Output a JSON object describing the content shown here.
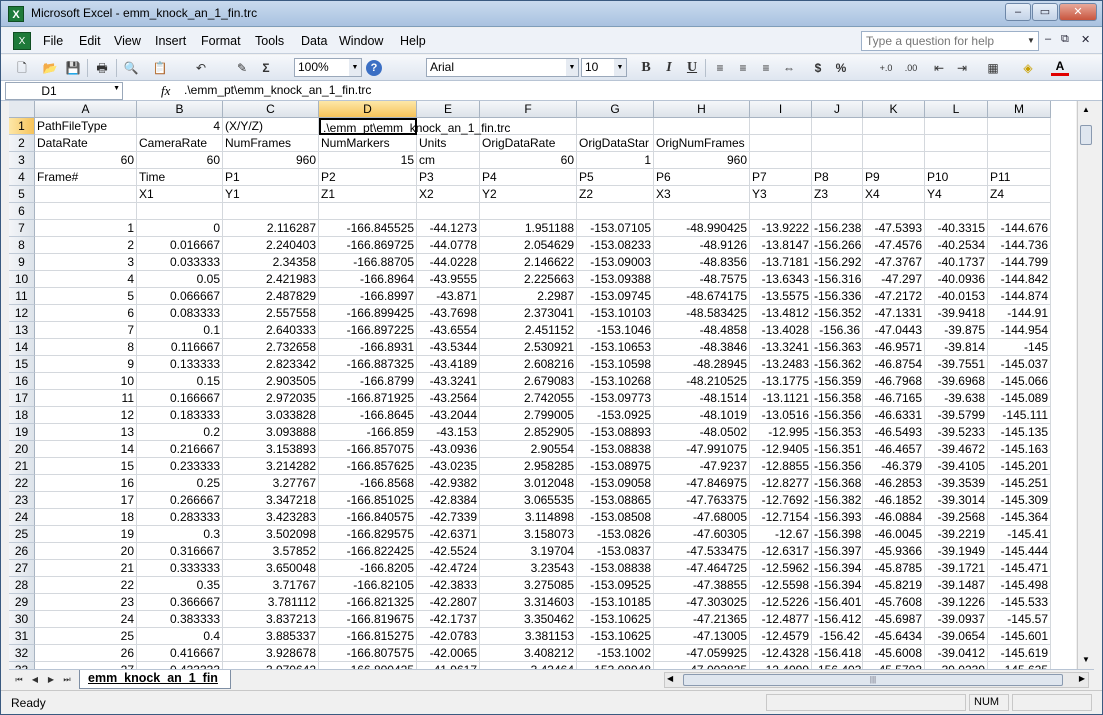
{
  "window": {
    "title": "Microsoft Excel - emm_knock_an_1_fin.trc",
    "app_icon_glyph": "X",
    "buttons": {
      "minimize": "–",
      "maximize": "▭",
      "close": "✕"
    }
  },
  "menubar": {
    "items": [
      "File",
      "Edit",
      "View",
      "Insert",
      "Format",
      "Tools",
      "Data",
      "Window",
      "Help"
    ],
    "help_placeholder": "Type a question for help",
    "mdi_buttons": [
      "–",
      "⧉",
      "✕"
    ]
  },
  "toolbar": {
    "zoom": "100%",
    "font": "Arial",
    "size": "10",
    "glyphs": {
      "new": "🗋",
      "open": "📂",
      "save": "💾",
      "print": "🖶",
      "research": "🔍",
      "paste": "📋",
      "undo": "↶",
      "clear": "✎",
      "sum": "Σ",
      "help": "?",
      "bold": "B",
      "italic": "I",
      "underline": "U",
      "align_left": "≡",
      "align_center": "≡",
      "align_right": "≡",
      "merge": "⇔",
      "currency": "$",
      "percent": "%",
      "inc_decimal": "+.0",
      "dec_decimal": ".00",
      "dec_indent": "⇤",
      "inc_indent": "⇥",
      "borders": "▦",
      "fill": "◈",
      "font_color": "A"
    }
  },
  "formula_bar": {
    "name_box": "D1",
    "fx": "fx",
    "value": ".\\emm_pt\\emm_knock_an_1_fin.trc"
  },
  "sheet": {
    "columns": [
      "A",
      "B",
      "C",
      "D",
      "E",
      "F",
      "G",
      "H",
      "I",
      "J",
      "K",
      "L",
      "M"
    ],
    "selected_column": "D",
    "selected_row": "1",
    "rows": [
      {
        "n": "1",
        "c": [
          "PathFileType",
          "4",
          "(X/Y/Z)",
          ".\\emm_pt\\emm_knock_an_1_fin.trc",
          "",
          "",
          "",
          "",
          "",
          "",
          "",
          "",
          ""
        ]
      },
      {
        "n": "2",
        "c": [
          "DataRate",
          "CameraRate",
          "NumFrames",
          "NumMarkers",
          "Units",
          "OrigDataRate",
          "OrigDataStar",
          "OrigNumFrames",
          "",
          "",
          "",
          "",
          ""
        ]
      },
      {
        "n": "3",
        "c": [
          "60",
          "60",
          "960",
          "15",
          "cm",
          "60",
          "1",
          "960",
          "",
          "",
          "",
          "",
          ""
        ]
      },
      {
        "n": "4",
        "c": [
          "Frame#",
          "Time",
          "P1",
          "P2",
          "P3",
          "P4",
          "P5",
          "P6",
          "P7",
          "P8",
          "P9",
          "P10",
          "P11"
        ]
      },
      {
        "n": "5",
        "c": [
          "",
          "X1",
          "Y1",
          "Z1",
          "X2",
          "Y2",
          "Z2",
          "X3",
          "Y3",
          "Z3",
          "X4",
          "Y4",
          "Z4"
        ]
      },
      {
        "n": "6",
        "c": [
          "",
          "",
          "",
          "",
          "",
          "",
          "",
          "",
          "",
          "",
          "",
          "",
          ""
        ]
      },
      {
        "n": "7",
        "c": [
          "1",
          "0",
          "2.116287",
          "-166.845525",
          "-44.1273",
          "1.951188",
          "-153.07105",
          "-48.990425",
          "-13.9222",
          "-156.238",
          "-47.5393",
          "-40.3315",
          "-144.676"
        ]
      },
      {
        "n": "8",
        "c": [
          "2",
          "0.016667",
          "2.240403",
          "-166.869725",
          "-44.0778",
          "2.054629",
          "-153.08233",
          "-48.9126",
          "-13.8147",
          "-156.266",
          "-47.4576",
          "-40.2534",
          "-144.736"
        ]
      },
      {
        "n": "9",
        "c": [
          "3",
          "0.033333",
          "2.34358",
          "-166.88705",
          "-44.0228",
          "2.146622",
          "-153.09003",
          "-48.8356",
          "-13.7181",
          "-156.292",
          "-47.3767",
          "-40.1737",
          "-144.799"
        ]
      },
      {
        "n": "10",
        "c": [
          "4",
          "0.05",
          "2.421983",
          "-166.8964",
          "-43.9555",
          "2.225663",
          "-153.09388",
          "-48.7575",
          "-13.6343",
          "-156.316",
          "-47.297",
          "-40.0936",
          "-144.842"
        ]
      },
      {
        "n": "11",
        "c": [
          "5",
          "0.066667",
          "2.487829",
          "-166.8997",
          "-43.871",
          "2.2987",
          "-153.09745",
          "-48.674175",
          "-13.5575",
          "-156.336",
          "-47.2172",
          "-40.0153",
          "-144.874"
        ]
      },
      {
        "n": "12",
        "c": [
          "6",
          "0.083333",
          "2.557558",
          "-166.899425",
          "-43.7698",
          "2.373041",
          "-153.10103",
          "-48.583425",
          "-13.4812",
          "-156.352",
          "-47.1331",
          "-39.9418",
          "-144.91"
        ]
      },
      {
        "n": "13",
        "c": [
          "7",
          "0.1",
          "2.640333",
          "-166.897225",
          "-43.6554",
          "2.451152",
          "-153.1046",
          "-48.4858",
          "-13.4028",
          "-156.36",
          "-47.0443",
          "-39.875",
          "-144.954"
        ]
      },
      {
        "n": "14",
        "c": [
          "8",
          "0.116667",
          "2.732658",
          "-166.8931",
          "-43.5344",
          "2.530921",
          "-153.10653",
          "-48.3846",
          "-13.3241",
          "-156.363",
          "-46.9571",
          "-39.814",
          "-145"
        ]
      },
      {
        "n": "15",
        "c": [
          "9",
          "0.133333",
          "2.823342",
          "-166.887325",
          "-43.4189",
          "2.608216",
          "-153.10598",
          "-48.28945",
          "-13.2483",
          "-156.362",
          "-46.8754",
          "-39.7551",
          "-145.037"
        ]
      },
      {
        "n": "16",
        "c": [
          "10",
          "0.15",
          "2.903505",
          "-166.8799",
          "-43.3241",
          "2.679083",
          "-153.10268",
          "-48.210525",
          "-13.1775",
          "-156.359",
          "-46.7968",
          "-39.6968",
          "-145.066"
        ]
      },
      {
        "n": "17",
        "c": [
          "11",
          "0.166667",
          "2.972035",
          "-166.871925",
          "-43.2564",
          "2.742055",
          "-153.09773",
          "-48.1514",
          "-13.1121",
          "-156.358",
          "-46.7165",
          "-39.638",
          "-145.089"
        ]
      },
      {
        "n": "18",
        "c": [
          "12",
          "0.183333",
          "3.033828",
          "-166.8645",
          "-43.2044",
          "2.799005",
          "-153.0925",
          "-48.1019",
          "-13.0516",
          "-156.356",
          "-46.6331",
          "-39.5799",
          "-145.111"
        ]
      },
      {
        "n": "19",
        "c": [
          "13",
          "0.2",
          "3.093888",
          "-166.859",
          "-43.153",
          "2.852905",
          "-153.08893",
          "-48.0502",
          "-12.995",
          "-156.353",
          "-46.5493",
          "-39.5233",
          "-145.135"
        ]
      },
      {
        "n": "20",
        "c": [
          "14",
          "0.216667",
          "3.153893",
          "-166.857075",
          "-43.0936",
          "2.90554",
          "-153.08838",
          "-47.991075",
          "-12.9405",
          "-156.351",
          "-46.4657",
          "-39.4672",
          "-145.163"
        ]
      },
      {
        "n": "21",
        "c": [
          "15",
          "0.233333",
          "3.214282",
          "-166.857625",
          "-43.0235",
          "2.958285",
          "-153.08975",
          "-47.9237",
          "-12.8855",
          "-156.356",
          "-46.379",
          "-39.4105",
          "-145.201"
        ]
      },
      {
        "n": "22",
        "c": [
          "16",
          "0.25",
          "3.27767",
          "-166.8568",
          "-42.9382",
          "3.012048",
          "-153.09058",
          "-47.846975",
          "-12.8277",
          "-156.368",
          "-46.2853",
          "-39.3539",
          "-145.251"
        ]
      },
      {
        "n": "23",
        "c": [
          "17",
          "0.266667",
          "3.347218",
          "-166.851025",
          "-42.8384",
          "3.065535",
          "-153.08865",
          "-47.763375",
          "-12.7692",
          "-156.382",
          "-46.1852",
          "-39.3014",
          "-145.309"
        ]
      },
      {
        "n": "24",
        "c": [
          "18",
          "0.283333",
          "3.423283",
          "-166.840575",
          "-42.7339",
          "3.114898",
          "-153.08508",
          "-47.68005",
          "-12.7154",
          "-156.393",
          "-46.0884",
          "-39.2568",
          "-145.364"
        ]
      },
      {
        "n": "25",
        "c": [
          "19",
          "0.3",
          "3.502098",
          "-166.829575",
          "-42.6371",
          "3.158073",
          "-153.0826",
          "-47.60305",
          "-12.67",
          "-156.398",
          "-46.0045",
          "-39.2219",
          "-145.41"
        ]
      },
      {
        "n": "26",
        "c": [
          "20",
          "0.316667",
          "3.57852",
          "-166.822425",
          "-42.5524",
          "3.19704",
          "-153.0837",
          "-47.533475",
          "-12.6317",
          "-156.397",
          "-45.9366",
          "-39.1949",
          "-145.444"
        ]
      },
      {
        "n": "27",
        "c": [
          "21",
          "0.333333",
          "3.650048",
          "-166.8205",
          "-42.4724",
          "3.23543",
          "-153.08838",
          "-47.464725",
          "-12.5962",
          "-156.394",
          "-45.8785",
          "-39.1721",
          "-145.471"
        ]
      },
      {
        "n": "28",
        "c": [
          "22",
          "0.35",
          "3.71767",
          "-166.82105",
          "-42.3833",
          "3.275085",
          "-153.09525",
          "-47.38855",
          "-12.5598",
          "-156.394",
          "-45.8219",
          "-39.1487",
          "-145.498"
        ]
      },
      {
        "n": "29",
        "c": [
          "23",
          "0.366667",
          "3.781112",
          "-166.821325",
          "-42.2807",
          "3.314603",
          "-153.10185",
          "-47.303025",
          "-12.5226",
          "-156.401",
          "-45.7608",
          "-39.1226",
          "-145.533"
        ]
      },
      {
        "n": "30",
        "c": [
          "24",
          "0.383333",
          "3.837213",
          "-166.819675",
          "-42.1737",
          "3.350462",
          "-153.10625",
          "-47.21365",
          "-12.4877",
          "-156.412",
          "-45.6987",
          "-39.0937",
          "-145.57"
        ]
      },
      {
        "n": "31",
        "c": [
          "25",
          "0.4",
          "3.885337",
          "-166.815275",
          "-42.0783",
          "3.381153",
          "-153.10625",
          "-47.13005",
          "-12.4579",
          "-156.42",
          "-45.6434",
          "-39.0654",
          "-145.601"
        ]
      },
      {
        "n": "32",
        "c": [
          "26",
          "0.416667",
          "3.928678",
          "-166.807575",
          "-42.0065",
          "3.408212",
          "-153.1002",
          "-47.059925",
          "-12.4328",
          "-156.418",
          "-45.6008",
          "-39.0412",
          "-145.619"
        ]
      },
      {
        "n": "33",
        "c": [
          "27",
          "0.433333",
          "3.970642",
          "-166.800425",
          "-41.9617",
          "3.43464",
          "-153.08948",
          "-47.003825",
          "-12.4099",
          "-156.403",
          "-45.5703",
          "-39.0239",
          "-145.625"
        ]
      }
    ]
  },
  "sheet_tabs": {
    "nav": [
      "⏮",
      "◀",
      "▶",
      "⏭"
    ],
    "active": "emm_knock_an_1_fin"
  },
  "hscroll_grip": "|||",
  "status": {
    "text": "Ready",
    "num": "NUM"
  }
}
